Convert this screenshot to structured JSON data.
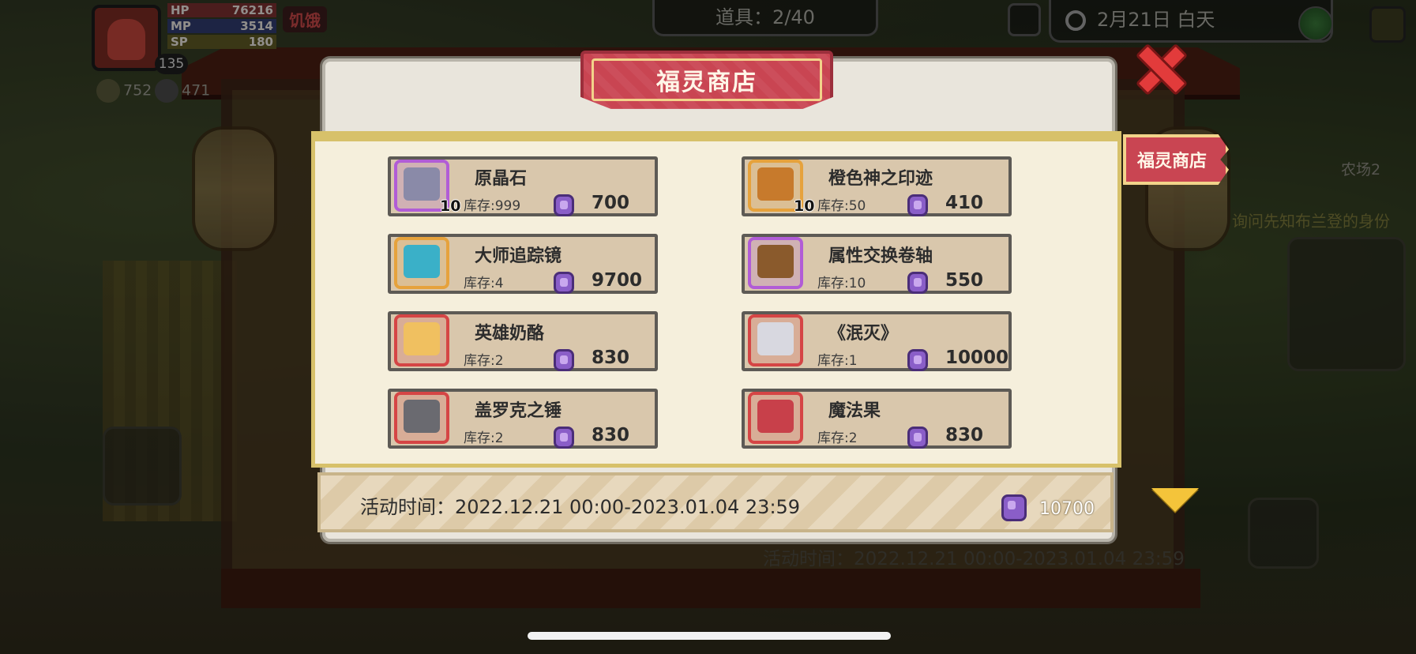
{
  "hud": {
    "hp_label": "HP",
    "hp_value": "76216",
    "mp_label": "MP",
    "mp_value": "3514",
    "sp_label": "SP",
    "sp_value": "180",
    "level": "135",
    "status": "饥饿",
    "resource_1": "752",
    "resource_2": "471",
    "items_count": "道具：2/40",
    "date": "2月21日 白天",
    "farm_label": "农场2",
    "quest_text": "询问先知布兰登的身份"
  },
  "shop": {
    "title": "福灵商店",
    "side_tab": "福灵商店",
    "activity_time": "活动时间：2022.12.21 00:00-2023.01.04 23:59",
    "balance": "10700",
    "items": [
      {
        "name": "原晶石",
        "stock": "库存:999",
        "price": "700",
        "qty": "10",
        "rarity_color": "#b15cd6",
        "art_color": "#8a8aa8",
        "icon": "crystal-ore-icon"
      },
      {
        "name": "橙色神之印迹",
        "stock": "库存:50",
        "price": "410",
        "qty": "10",
        "rarity_color": "#e6a23c",
        "art_color": "#c77a2c",
        "icon": "orange-sigil-icon"
      },
      {
        "name": "大师追踪镜",
        "stock": "库存:4",
        "price": "9700",
        "qty": "",
        "rarity_color": "#e6a23c",
        "art_color": "#3ab0c8",
        "icon": "tracking-goggles-icon"
      },
      {
        "name": "属性交换卷轴",
        "stock": "库存:10",
        "price": "550",
        "qty": "",
        "rarity_color": "#b15cd6",
        "art_color": "#8a5a2c",
        "icon": "exchange-scroll-icon"
      },
      {
        "name": "英雄奶酪",
        "stock": "库存:2",
        "price": "830",
        "qty": "",
        "rarity_color": "#d54545",
        "art_color": "#f0c060",
        "icon": "cheese-icon"
      },
      {
        "name": "《泯灭》",
        "stock": "库存:1",
        "price": "10000",
        "qty": "",
        "rarity_color": "#d54545",
        "art_color": "#d8d8e0",
        "icon": "cannon-weapon-icon"
      },
      {
        "name": "盖罗克之锤",
        "stock": "库存:2",
        "price": "830",
        "qty": "",
        "rarity_color": "#d54545",
        "art_color": "#6a6a70",
        "icon": "hammer-icon"
      },
      {
        "name": "魔法果",
        "stock": "库存:2",
        "price": "830",
        "qty": "",
        "rarity_color": "#d54545",
        "art_color": "#c8404a",
        "icon": "magic-fruit-icon"
      }
    ]
  },
  "background": {
    "activity_time": "活动时间：2022.12.21 00:00-2023.01.04 23:59"
  }
}
